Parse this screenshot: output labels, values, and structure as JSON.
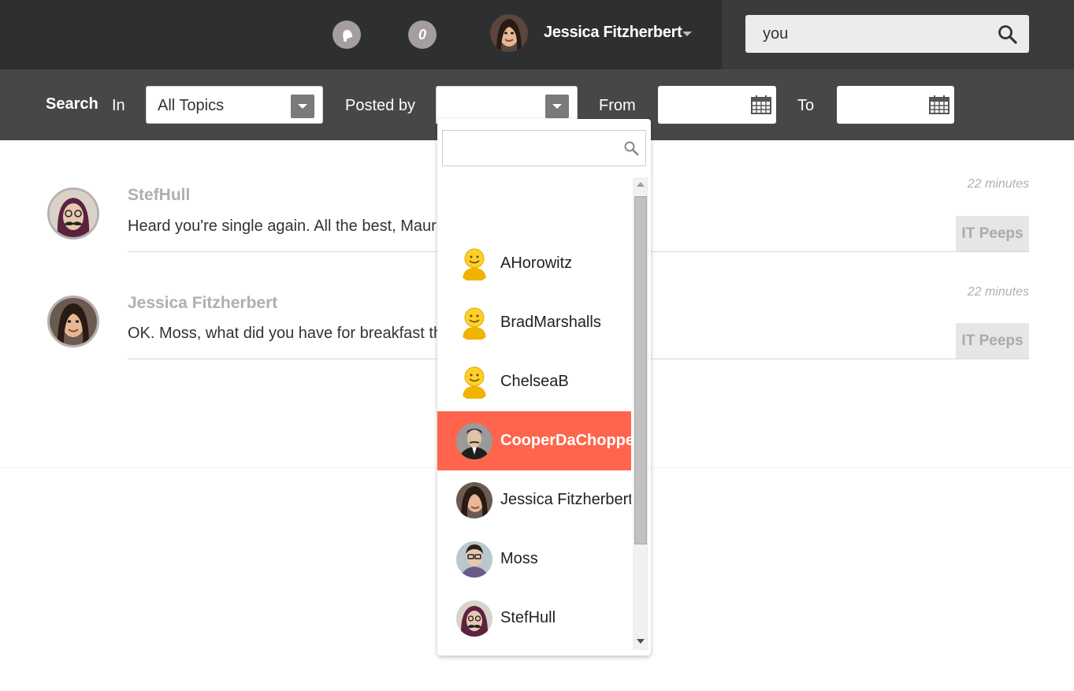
{
  "header": {
    "notification_count": "0",
    "user_name": "Jessica Fitzherbert",
    "search_value": "you"
  },
  "filters": {
    "search_label": "Search",
    "in_label": "In",
    "topic_value": "All Topics",
    "posted_by_label": "Posted by",
    "posted_by_value": "",
    "from_label": "From",
    "to_label": "To"
  },
  "feed": [
    {
      "author": "StefHull",
      "message": "Heard you're single again. All the best, Mauric",
      "time": "22 minutes",
      "tag": "IT Peeps"
    },
    {
      "author": "Jessica Fitzherbert",
      "message": "OK. Moss, what did you have for breakfast th",
      "time": "22 minutes",
      "tag": "IT Peeps"
    }
  ],
  "dropdown": {
    "search_value": "",
    "items": [
      {
        "name": "AHorowitz",
        "avatar": "smiley-placeholder-icon"
      },
      {
        "name": "BradMarshalls",
        "avatar": "smiley-placeholder-icon"
      },
      {
        "name": "ChelseaB",
        "avatar": "smiley-placeholder-icon"
      },
      {
        "name": "CooperDaChopper",
        "avatar": "photo",
        "selected": true
      },
      {
        "name": "Jessica Fitzherbert",
        "avatar": "photo"
      },
      {
        "name": "Moss",
        "avatar": "photo"
      },
      {
        "name": "StefHull",
        "avatar": "photo"
      }
    ]
  },
  "colors": {
    "topbar": "#2e2f31",
    "filterbar": "#474747",
    "accent_selected": "#fe654c",
    "author_text": "#b5adad"
  }
}
